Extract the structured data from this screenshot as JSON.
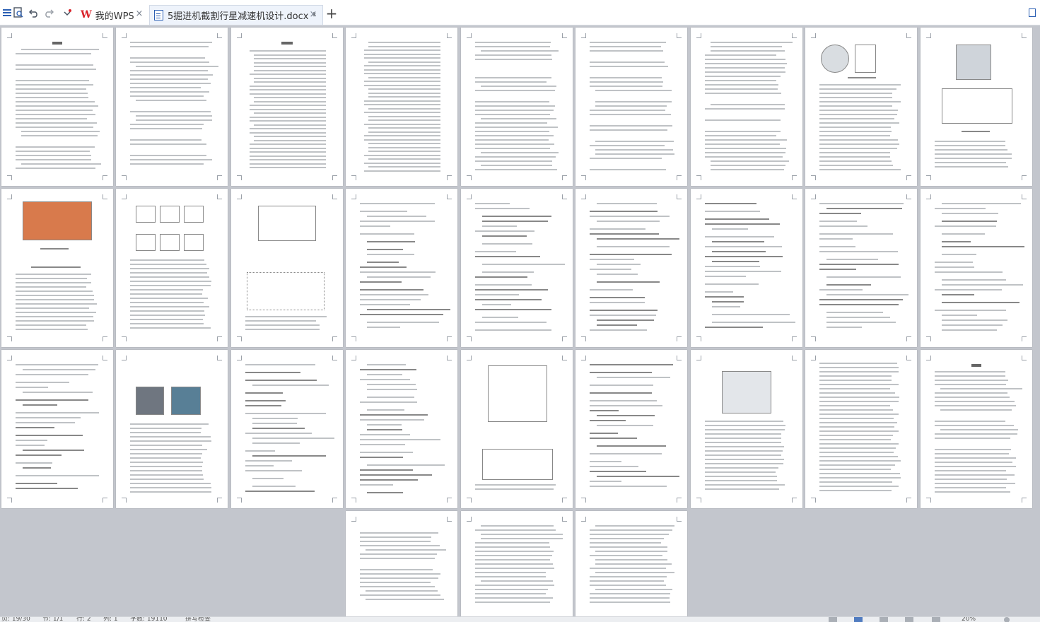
{
  "toolbar": {
    "icons": [
      "menu-icon",
      "print-preview-icon",
      "undo-icon",
      "redo-icon",
      "more-icon"
    ]
  },
  "tabs": [
    {
      "label": "我的WPS",
      "close": "×"
    },
    {
      "label": "5掘进机截割行星减速机设计.docx *",
      "close": "×"
    }
  ],
  "add_tab": "+",
  "status": {
    "page": "页: 19/30",
    "section": "节: 1/1",
    "row": "行: 2",
    "col": "列: 1",
    "words": "字数: 19110",
    "spell": "拼写检查",
    "zoom": "20%"
  },
  "pages": {
    "count": 30,
    "per_row": 9
  }
}
